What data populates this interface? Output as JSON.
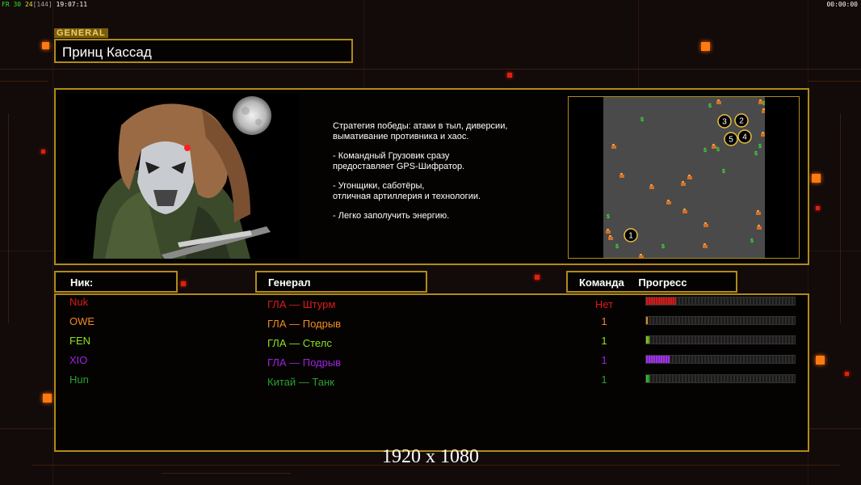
{
  "hud": {
    "fps_label": "FR",
    "fps_value": "30",
    "fps_target": "24",
    "fps_extra": "[144]",
    "clock": "19:07:11",
    "timer": "00:00:00"
  },
  "general": {
    "tag": "GENERAL",
    "name": "Принц Кассад"
  },
  "description": [
    "Стратегия победы: атаки в тыл, диверсии,\n вымативание противника и хаос.",
    "- Командный Грузовик сразу\nпредоставляет GPS-Шифратор.",
    "- Угонщики, саботёры,\nотличная артиллерия и технологии.",
    "- Легко заполучить энергию."
  ],
  "headers": {
    "nick": "Ник:",
    "general": "Генерал",
    "team": "Команда",
    "progress": "Прогресс"
  },
  "players": [
    {
      "nick": "Nuk",
      "general": "ГЛА — Штурм",
      "team": "Нет",
      "progress": 0.2,
      "color": "#e01818",
      "fill": "#d01a1a"
    },
    {
      "nick": "OWE",
      "general": "ГЛА — Подрыв",
      "team": "1",
      "progress": 0.01,
      "color": "#f08a20",
      "fill": "#e08a20"
    },
    {
      "nick": "FEN",
      "general": "ГЛА — Стелс",
      "team": "1",
      "progress": 0.02,
      "color": "#8ee020",
      "fill": "#7ed020"
    },
    {
      "nick": "XIO",
      "general": "ГЛА — Подрыв",
      "team": "1",
      "progress": 0.16,
      "color": "#a020e0",
      "fill": "#a030f0"
    },
    {
      "nick": "Hun",
      "general": "Китай — Танк",
      "team": "1",
      "progress": 0.02,
      "color": "#2aa030",
      "fill": "#30c030"
    }
  ],
  "minimap": {
    "start_positions": [
      "1",
      "2",
      "3",
      "4",
      "5"
    ],
    "money_symbol": "$"
  },
  "resolution_label": "1920 x 1080",
  "colors": {
    "frame": "#b08a1a",
    "accent": "#ff7a10",
    "background": "#120b0a"
  }
}
